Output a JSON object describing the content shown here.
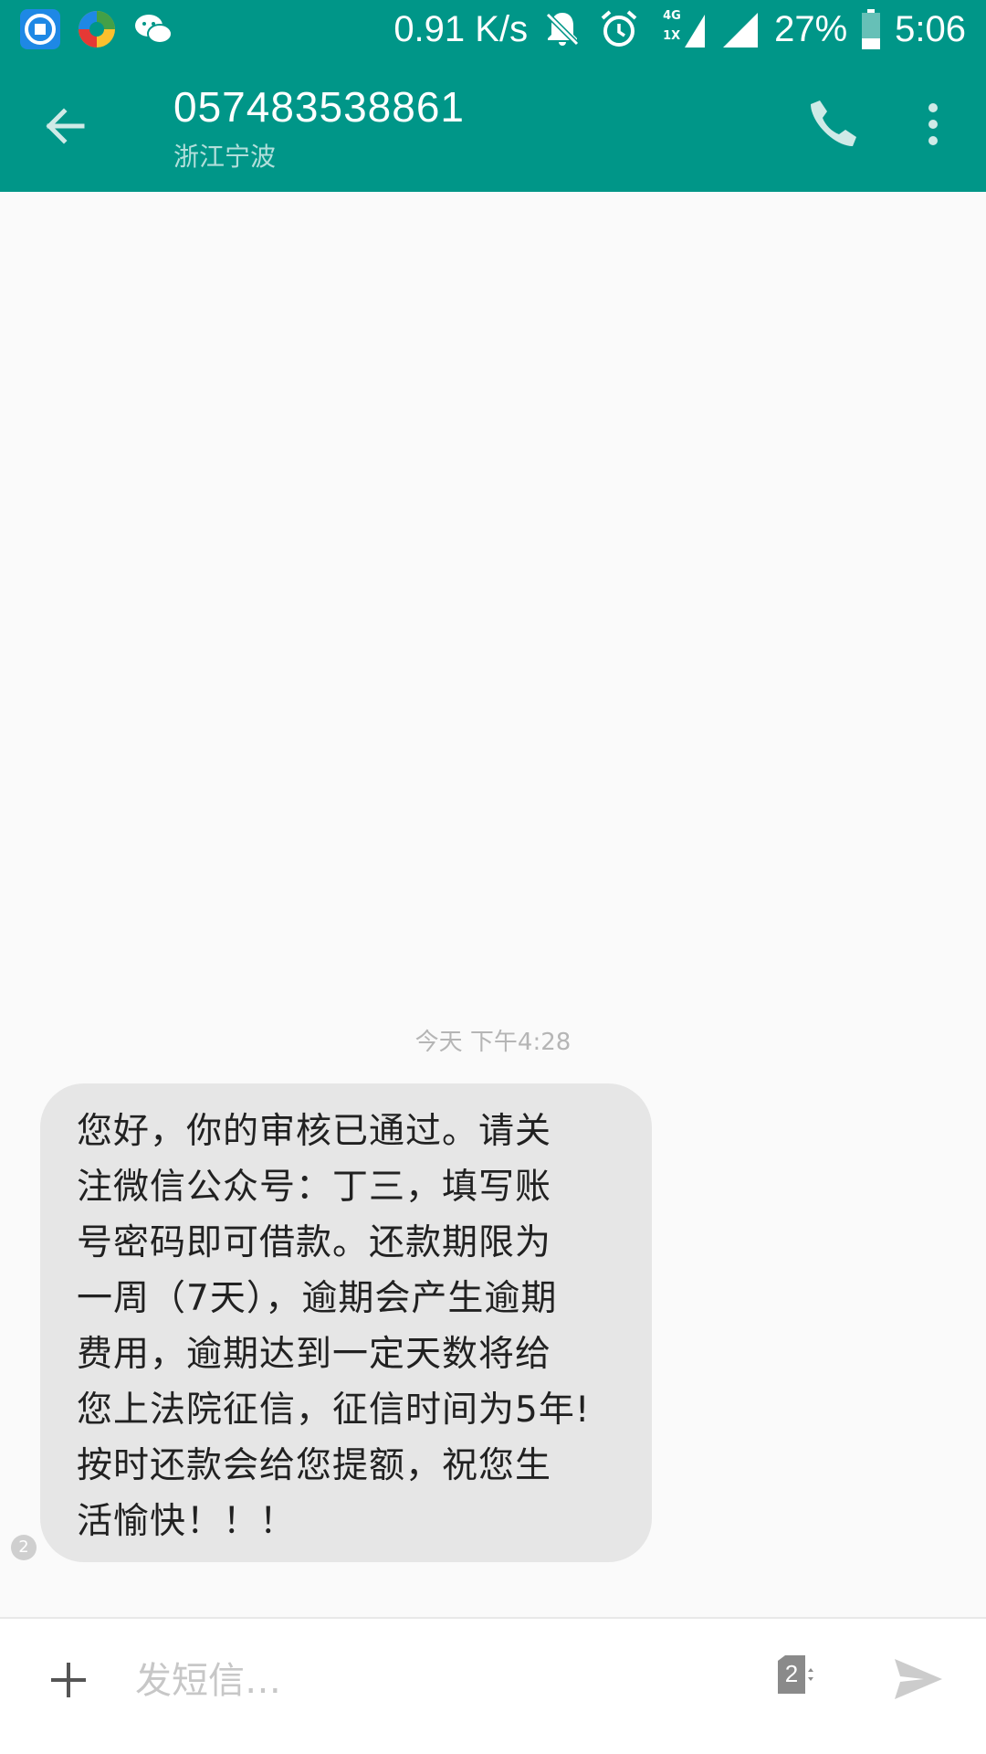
{
  "status_bar": {
    "app_icons": [
      "notification-app-icon",
      "colorful-app-icon",
      "wechat-icon"
    ],
    "net_speed": "0.91 K/s",
    "network_label_top": "4G",
    "network_label_bottom": "1X",
    "battery": "27%",
    "time": "5:06"
  },
  "header": {
    "back_icon": "arrow-left-icon",
    "phone_number": "057483538861",
    "location": "浙江宁波",
    "call_icon": "phone-icon",
    "more_icon": "more-vert-icon"
  },
  "conversation": {
    "timestamp": "今天 下午4:28",
    "messages": [
      {
        "text": "您好，你的审核已通过。请关\n注微信公众号：丁三，填写账\n号密码即可借款。还款期限为\n一周（7天），逾期会产生逾期\n费用，逾期达到一定天数将给\n您上法院征信，征信时间为5年!\n按时还款会给您提额，祝您生\n活愉快！！！",
        "sim": "2"
      }
    ]
  },
  "composer": {
    "add_icon": "plus-icon",
    "placeholder": "发短信…",
    "sim_selector": "2",
    "send_icon": "send-icon"
  },
  "colors": {
    "primary": "#009688",
    "bubble": "#e6e6e6",
    "background": "#fafafa"
  }
}
